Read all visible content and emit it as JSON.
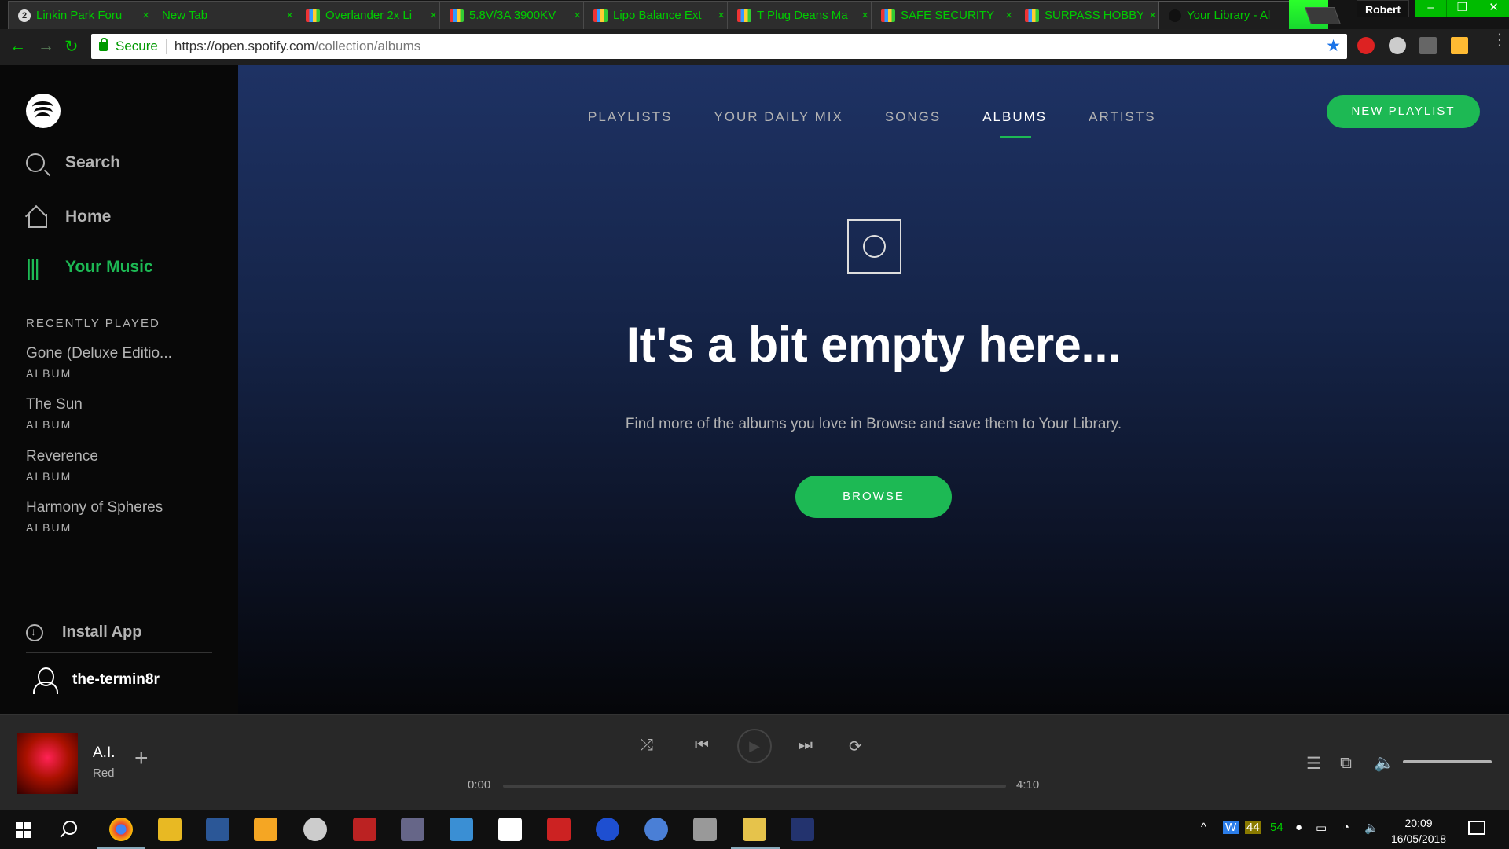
{
  "browser": {
    "tabs": [
      {
        "title": "Linkin Park Foru",
        "favicon": "lp"
      },
      {
        "title": "New Tab",
        "favicon": "none"
      },
      {
        "title": "Overlander 2x Li",
        "favicon": "shop"
      },
      {
        "title": "5.8V/3A 3900KV",
        "favicon": "shop"
      },
      {
        "title": "Lipo Balance Ext",
        "favicon": "shop"
      },
      {
        "title": "T Plug Deans Ma",
        "favicon": "shop"
      },
      {
        "title": "SAFE SECURITY",
        "favicon": "shop"
      },
      {
        "title": "SURPASS HOBBY",
        "favicon": "shop"
      },
      {
        "title": "Your Library - Al",
        "favicon": "sp",
        "active": true
      }
    ],
    "user_badge": "Robert",
    "secure_label": "Secure",
    "url_host": "https://open.spotify.com",
    "url_path": "/collection/albums"
  },
  "sidebar": {
    "nav": [
      {
        "label": "Search",
        "icon": "search-icon"
      },
      {
        "label": "Home",
        "icon": "home-icon"
      },
      {
        "label": "Your Music",
        "icon": "library-icon",
        "active": true
      }
    ],
    "recently_played_title": "RECENTLY PLAYED",
    "recently_played": [
      {
        "name": "Gone (Deluxe Editio...",
        "kind": "ALBUM"
      },
      {
        "name": "The Sun",
        "kind": "ALBUM"
      },
      {
        "name": "Reverence",
        "kind": "ALBUM"
      },
      {
        "name": "Harmony of Spheres",
        "kind": "ALBUM"
      }
    ],
    "install_app": "Install App",
    "username": "the-termin8r"
  },
  "main": {
    "tabs": [
      "PLAYLISTS",
      "YOUR DAILY MIX",
      "SONGS",
      "ALBUMS",
      "ARTISTS"
    ],
    "active_tab": "ALBUMS",
    "new_playlist": "NEW PLAYLIST",
    "empty_title": "It's a bit empty here...",
    "empty_text": "Find more of the albums you love in Browse and save them to Your Library.",
    "browse_button": "BROWSE"
  },
  "player": {
    "track": "A.I.",
    "artist": "Red",
    "elapsed": "0:00",
    "duration": "4:10",
    "progress": 0
  },
  "taskbar": {
    "time": "20:09",
    "date": "16/05/2018",
    "tray_num1": "44",
    "tray_num2": "54"
  },
  "colors": {
    "accent": "#1db954",
    "sidebar_bg": "#080808",
    "player_bg": "#282828"
  }
}
